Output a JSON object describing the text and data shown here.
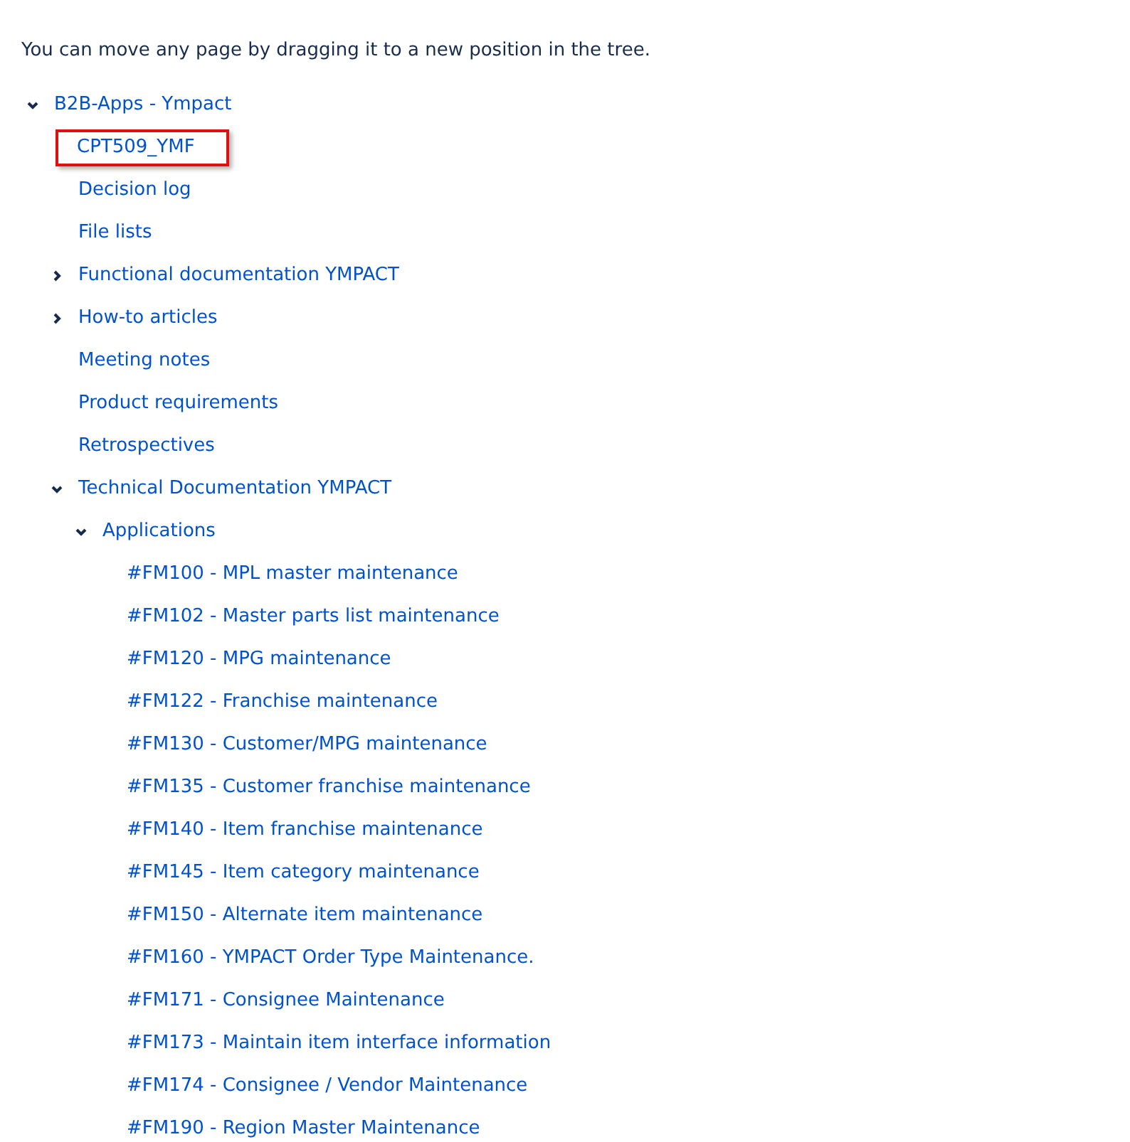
{
  "intro": "You can move any page by dragging it to a new position in the tree.",
  "tree": [
    {
      "label": "B2B-Apps - Ympact",
      "expanded": true,
      "highlighted": false,
      "children": [
        {
          "label": "CPT509_YMF",
          "highlighted": true
        },
        {
          "label": "Decision log",
          "highlighted": false
        },
        {
          "label": "File lists",
          "highlighted": false
        },
        {
          "label": "Functional documentation YMPACT",
          "expanded": false,
          "highlighted": false
        },
        {
          "label": "How-to articles",
          "expanded": false,
          "highlighted": false
        },
        {
          "label": "Meeting notes",
          "highlighted": false
        },
        {
          "label": "Product requirements",
          "highlighted": false
        },
        {
          "label": "Retrospectives",
          "highlighted": false
        },
        {
          "label": "Technical Documentation YMPACT",
          "expanded": true,
          "highlighted": false,
          "children": [
            {
              "label": "Applications",
              "expanded": true,
              "highlighted": false,
              "children": [
                {
                  "label": "#FM100 - MPL master maintenance",
                  "highlighted": false
                },
                {
                  "label": "#FM102 - Master parts list maintenance",
                  "highlighted": false
                },
                {
                  "label": "#FM120 - MPG maintenance",
                  "highlighted": false
                },
                {
                  "label": "#FM122 - Franchise maintenance",
                  "highlighted": false
                },
                {
                  "label": "#FM130 - Customer/MPG maintenance",
                  "highlighted": false
                },
                {
                  "label": "#FM135 - Customer franchise maintenance",
                  "highlighted": false
                },
                {
                  "label": "#FM140 - Item franchise maintenance",
                  "highlighted": false
                },
                {
                  "label": "#FM145 - Item category maintenance",
                  "highlighted": false
                },
                {
                  "label": "#FM150 - Alternate item maintenance",
                  "highlighted": false
                },
                {
                  "label": "#FM160 - YMPACT Order Type Maintenance.",
                  "highlighted": false
                },
                {
                  "label": "#FM171 - Consignee Maintenance",
                  "highlighted": false
                },
                {
                  "label": "#FM173 - Maintain item interface information",
                  "highlighted": false
                },
                {
                  "label": "#FM174 - Consignee / Vendor Maintenance",
                  "highlighted": false
                },
                {
                  "label": "#FM190 - Region Master Maintenance",
                  "highlighted": false
                }
              ]
            }
          ]
        }
      ]
    }
  ]
}
